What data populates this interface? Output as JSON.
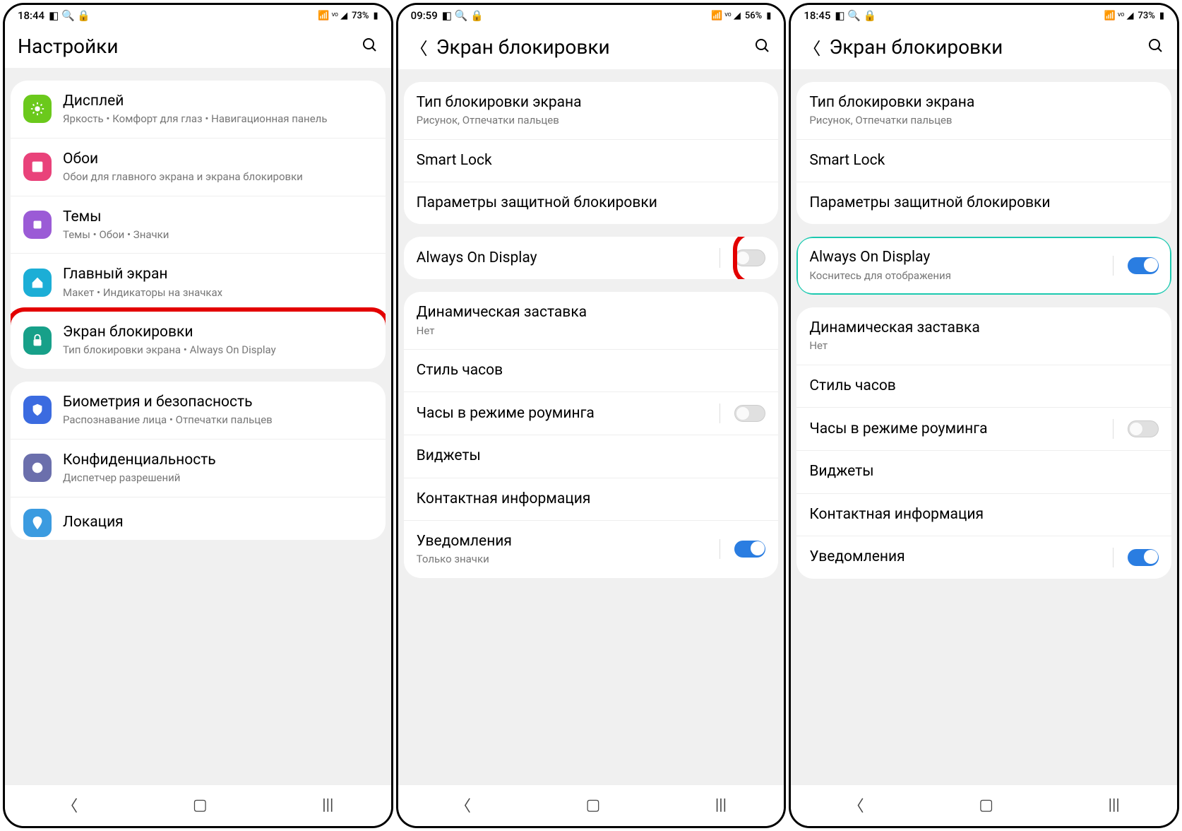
{
  "screens": [
    {
      "status": {
        "time": "18:44",
        "left_icons": "▢ Q 🔒",
        "right_text": "73%",
        "right_icons": "📶 VoLTE 📶 ◢"
      },
      "header": {
        "title": "Настройки",
        "has_back": false
      },
      "groups": [
        {
          "items": [
            {
              "icon_color": "#6bc91c",
              "icon": "sun",
              "title": "Дисплей",
              "sub": "Яркость  •  Комфорт для глаз  •  Навигационная панель"
            },
            {
              "icon_color": "#e9427a",
              "icon": "image",
              "title": "Обои",
              "sub": "Обои для главного экрана и экрана блокировки"
            },
            {
              "icon_color": "#9b5bd6",
              "icon": "palette",
              "title": "Темы",
              "sub": "Темы  •  Обои  •  Значки"
            },
            {
              "icon_color": "#1caed6",
              "icon": "home",
              "title": "Главный экран",
              "sub": "Макет  •  Индикаторы на значках"
            },
            {
              "icon_color": "#17a089",
              "icon": "lock",
              "title": "Экран блокировки",
              "sub": "Тип блокировки экрана  •  Always On Display",
              "highlight": "red"
            }
          ]
        },
        {
          "items": [
            {
              "icon_color": "#3b6be0",
              "icon": "shield",
              "title": "Биометрия и безопасность",
              "sub": "Распознавание лица  •  Отпечатки пальцев"
            },
            {
              "icon_color": "#6b6fac",
              "icon": "privacy",
              "title": "Конфиденциальность",
              "sub": "Диспетчер разрешений"
            },
            {
              "icon_color": "#888",
              "icon": "pin",
              "title": "Локация",
              "sub": ""
            }
          ]
        }
      ]
    },
    {
      "status": {
        "time": "09:59",
        "left_icons": "▢ Q 🔒",
        "right_text": "56%",
        "right_icons": "📶 VoLTE 📶 ◢"
      },
      "header": {
        "title": "Экран блокировки",
        "has_back": true
      },
      "groups": [
        {
          "items": [
            {
              "title": "Тип блокировки экрана",
              "sub": "Рисунок, Отпечатки пальцев"
            },
            {
              "title": "Smart Lock"
            },
            {
              "title": "Параметры защитной блокировки"
            }
          ]
        },
        {
          "items": [
            {
              "title": "Always On Display",
              "toggle": "off",
              "toggle_highlight": "red"
            }
          ]
        },
        {
          "items": [
            {
              "title": "Динамическая заставка",
              "sub": "Нет"
            },
            {
              "title": "Стиль часов"
            },
            {
              "title": "Часы в режиме роуминга",
              "toggle": "off"
            },
            {
              "title": "Виджеты"
            },
            {
              "title": "Контактная информация"
            },
            {
              "title": "Уведомления",
              "sub": "Только значки",
              "toggle": "on"
            }
          ]
        }
      ]
    },
    {
      "status": {
        "time": "18:45",
        "left_icons": "▢ Q 🔒",
        "right_text": "73%",
        "right_icons": "📶 VoLTE 📶 ◢"
      },
      "header": {
        "title": "Экран блокировки",
        "has_back": true
      },
      "groups": [
        {
          "items": [
            {
              "title": "Тип блокировки экрана",
              "sub": "Рисунок, Отпечатки пальцев"
            },
            {
              "title": "Smart Lock"
            },
            {
              "title": "Параметры защитной блокировки"
            }
          ]
        },
        {
          "items": [
            {
              "title": "Always On Display",
              "sub": "Коснитесь для отображения",
              "toggle": "on",
              "row_highlight": "teal"
            }
          ]
        },
        {
          "items": [
            {
              "title": "Динамическая заставка",
              "sub": "Нет"
            },
            {
              "title": "Стиль часов"
            },
            {
              "title": "Часы в режиме роуминга",
              "toggle": "off"
            },
            {
              "title": "Виджеты"
            },
            {
              "title": "Контактная информация"
            },
            {
              "title": "Уведомления",
              "toggle": "on"
            }
          ]
        }
      ]
    }
  ],
  "nav": {
    "back": "<",
    "home": "▢",
    "recent": "|||"
  }
}
